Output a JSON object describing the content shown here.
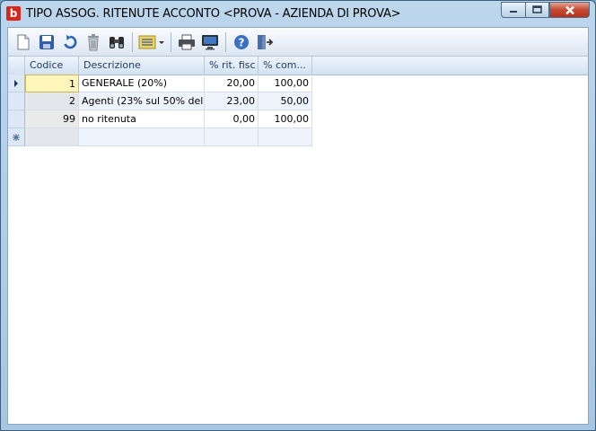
{
  "window": {
    "app_icon_letter": "b",
    "title": "TIPO ASSOG. RITENUTE ACCONTO <PROVA - AZIENDA DI PROVA>"
  },
  "toolbar": {
    "icons": [
      "new-document-icon",
      "save-icon",
      "undo-icon",
      "delete-icon",
      "find-binoculars-icon",
      "column-chooser-icon",
      "print-icon",
      "preview-monitor-icon",
      "help-icon",
      "exit-icon"
    ]
  },
  "grid": {
    "columns": [
      "Codice",
      "Descrizione",
      "% rit. fisc",
      "% com..."
    ],
    "rows": [
      {
        "codice": "1",
        "descrizione": "GENERALE (20%)",
        "rit_fisc": "20,00",
        "com": "100,00"
      },
      {
        "codice": "2",
        "descrizione": "Agenti (23% sul 50% del",
        "rit_fisc": "23,00",
        "com": "50,00"
      },
      {
        "codice": "99",
        "descrizione": "no ritenuta",
        "rit_fisc": "0,00",
        "com": "100,00"
      }
    ]
  },
  "colors": {
    "accent": "#d9261c",
    "header_text": "#1e395b"
  }
}
